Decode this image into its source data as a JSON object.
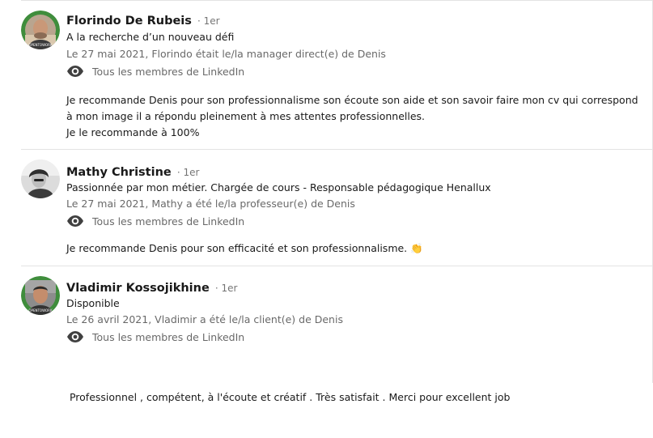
{
  "recommendations": [
    {
      "name": "Florindo De Rubeis",
      "degree": "· 1er",
      "headline": "A la recherche d’un nouveau défi",
      "date_relation": "Le 27 mai 2021, Florindo était le/la manager direct(e) de Denis",
      "visibility": "Tous les membres de LinkedIn",
      "text_lines": [
        "Je recommande Denis pour son professionnalisme son écoute son aide et son savoir faire mon cv qui correspond",
        "à mon image il a répondu pleinement à mes attentes professionnelles.",
        "Je le recommande à 100%"
      ],
      "avatar_badge": "OPENTOWORK"
    },
    {
      "name": "Mathy Christine",
      "degree": "· 1er",
      "headline": "Passionnée par mon métier. Chargée de cours - Responsable pédagogique Henallux",
      "date_relation": "Le 27 mai 2021, Mathy a été le/la professeur(e) de Denis",
      "visibility": "Tous les membres de LinkedIn",
      "text_lines": [
        "Je recommande Denis pour son efficacité et son professionnalisme. 👏"
      ]
    },
    {
      "name": "Vladimir Kossojikhine",
      "degree": "· 1er",
      "headline": "Disponible",
      "date_relation": "Le 26 avril 2021, Vladimir a été le/la client(e) de Denis",
      "visibility": "Tous les membres de LinkedIn",
      "text_lines": [
        " Professionnel , compétent, à l'écoute et créatif . Très satisfait . Merci pour excellent job"
      ],
      "avatar_badge": "OPENTOWORK"
    }
  ],
  "colors": {
    "opentowork_green": "#3f8d3c",
    "divider": "#e3e3e3"
  },
  "icons": {
    "visibility": "eye-icon"
  }
}
